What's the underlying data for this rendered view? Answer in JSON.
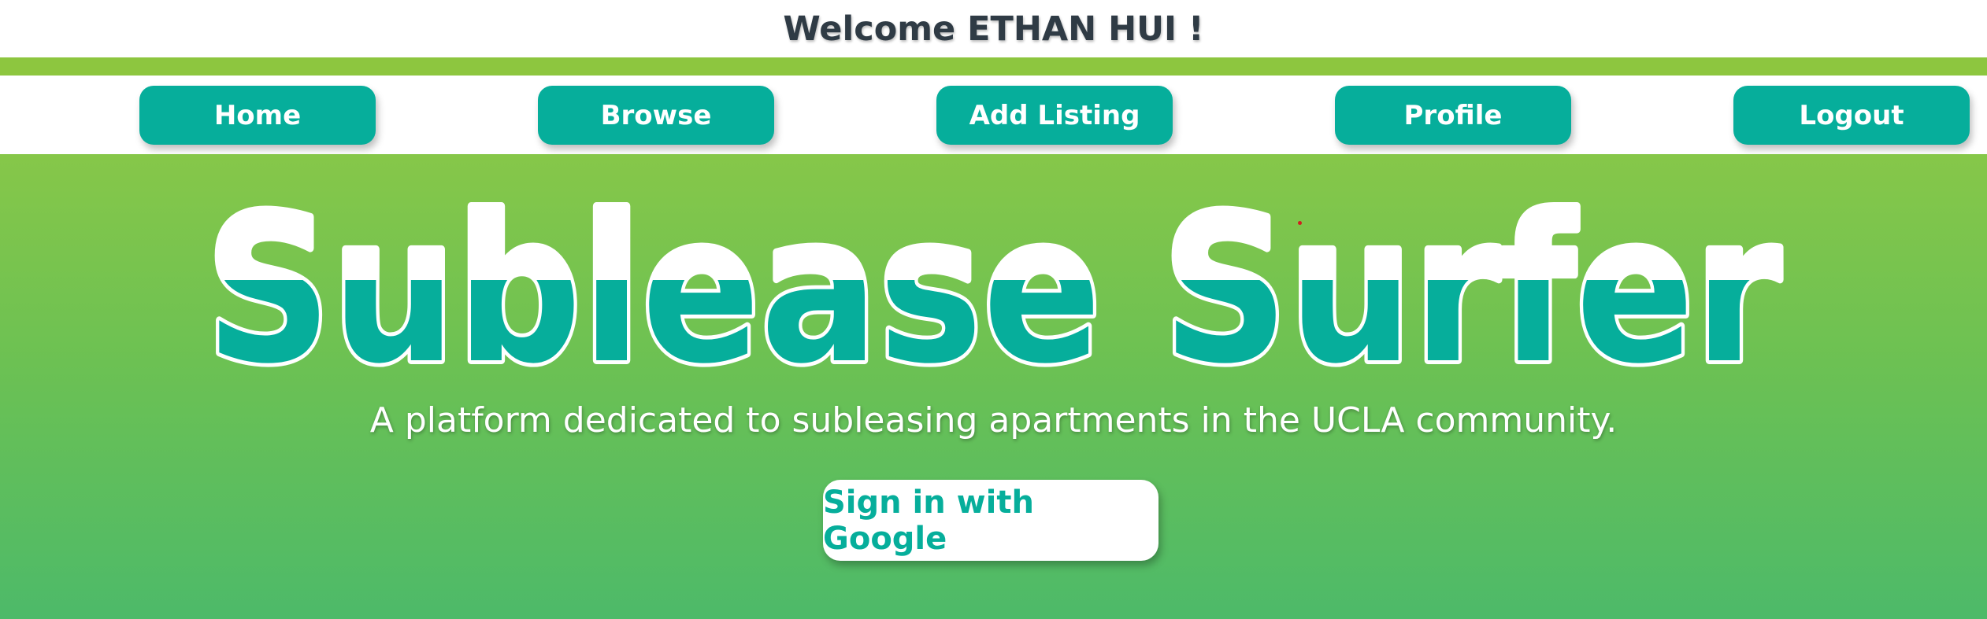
{
  "header": {
    "welcome": "Welcome ETHAN HUI !"
  },
  "nav": {
    "items": [
      {
        "label": "Home"
      },
      {
        "label": "Browse"
      },
      {
        "label": "Add Listing"
      },
      {
        "label": "Profile"
      },
      {
        "label": "Logout"
      }
    ]
  },
  "hero": {
    "title": "Sublease Surfer",
    "tagline": "A platform dedicated to subleasing apartments in the UCLA community.",
    "signin_label": "Sign in with Google"
  },
  "colors": {
    "accent_green": "#8dc63f",
    "teal": "#06ae9b",
    "gradient_top": "#86c749",
    "gradient_bottom": "#4dba69",
    "welcome_text": "#2f3b45"
  }
}
